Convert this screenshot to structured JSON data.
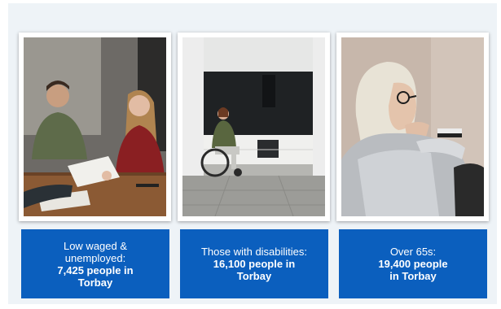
{
  "panels": [
    {
      "image": "two-people-reviewing-papers-at-table-photo",
      "line1": "Low waged &",
      "line2": "unemployed:",
      "line3": "7,425 people in",
      "line4": "Torbay"
    },
    {
      "image": "woman-in-wheelchair-in-kitchen-photo",
      "line1": "Those with disabilities:",
      "line2": "16,100 people in",
      "line3": "Torbay"
    },
    {
      "image": "older-woman-with-glasses-looking-out-window-photo",
      "line1": "Over 65s:",
      "line2": "19,400 people",
      "line3": "in Torbay"
    }
  ],
  "colors": {
    "caption_background": "#0b5fbe",
    "caption_text": "#ffffff",
    "slide_background": "#eef3f7"
  }
}
